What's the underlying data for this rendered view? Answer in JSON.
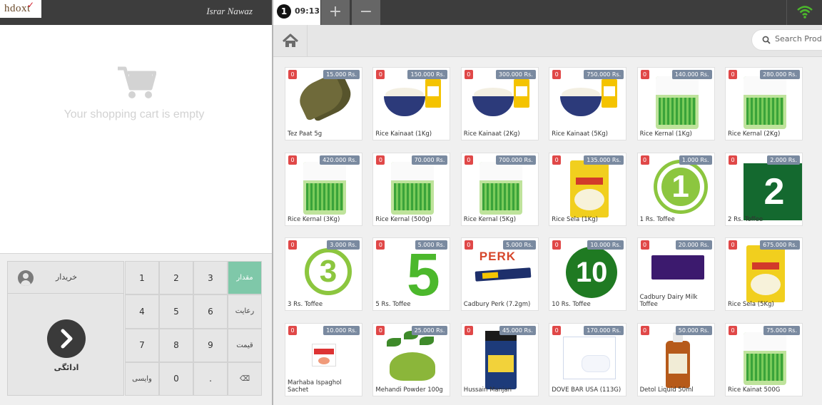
{
  "header": {
    "logo_text": "hdoxt",
    "user_name": "Israr Nawaz"
  },
  "cart": {
    "empty_message": "Your shopping cart is empty"
  },
  "customer": {
    "label": "خریدار"
  },
  "payment": {
    "label": "ادائگی"
  },
  "keypad": {
    "keys": [
      {
        "label": "1",
        "type": "digit"
      },
      {
        "label": "2",
        "type": "digit"
      },
      {
        "label": "3",
        "type": "digit"
      },
      {
        "label": "مقدار",
        "type": "func",
        "active": true
      },
      {
        "label": "4",
        "type": "digit"
      },
      {
        "label": "5",
        "type": "digit"
      },
      {
        "label": "6",
        "type": "digit"
      },
      {
        "label": "رعایت",
        "type": "func"
      },
      {
        "label": "7",
        "type": "digit"
      },
      {
        "label": "8",
        "type": "digit"
      },
      {
        "label": "9",
        "type": "digit"
      },
      {
        "label": "قیمت",
        "type": "func"
      },
      {
        "label": "وایسی",
        "type": "func"
      },
      {
        "label": "0",
        "type": "digit"
      },
      {
        "label": ".",
        "type": "digit"
      },
      {
        "label": "⌫",
        "type": "backspace"
      }
    ]
  },
  "order_tab": {
    "number": "1",
    "time": "09:13",
    "add_label": "+",
    "remove_label": "−"
  },
  "search": {
    "placeholder": "Search Produ"
  },
  "colors": {
    "topbar": "#3d3d3d",
    "qty_badge": "#e04848",
    "price_badge": "#7a8aa0",
    "active_key": "#7fc8a9",
    "wifi": "#4cb82c"
  },
  "products": [
    {
      "name": "Tez Paat 5g",
      "price": "15.000 Rs.",
      "qty": "0",
      "image": "bay-leaves"
    },
    {
      "name": "Rice Kainaat (1Kg)",
      "price": "150.000 Rs.",
      "qty": "0",
      "image": "rice-bowl"
    },
    {
      "name": "Rice Kainaat (2Kg)",
      "price": "300.000 Rs.",
      "qty": "0",
      "image": "rice-bowl"
    },
    {
      "name": "Rice Kainaat (5Kg)",
      "price": "750.000 Rs.",
      "qty": "0",
      "image": "rice-bowl"
    },
    {
      "name": "Rice Kernal (1Kg)",
      "price": "140.000 Rs.",
      "qty": "0",
      "image": "kernel-bag"
    },
    {
      "name": "Rice Kernal (2Kg)",
      "price": "280.000 Rs.",
      "qty": "0",
      "image": "kernel-bag"
    },
    {
      "name": "Rice Kernal (3Kg)",
      "price": "420.000 Rs.",
      "qty": "0",
      "image": "kernel-bag"
    },
    {
      "name": "Rice Kernal (500g)",
      "price": "70.000 Rs.",
      "qty": "0",
      "image": "kernel-bag"
    },
    {
      "name": "Rice Kernal (5Kg)",
      "price": "700.000 Rs.",
      "qty": "0",
      "image": "kernel-bag"
    },
    {
      "name": "Rice Sela (1Kg)",
      "price": "135.000 Rs.",
      "qty": "0",
      "image": "sela-bag"
    },
    {
      "name": "1 Rs. Toffee",
      "price": "1.000 Rs.",
      "qty": "0",
      "image": "number-1"
    },
    {
      "name": "2 Rs. Toffee",
      "price": "2.000 Rs.",
      "qty": "0",
      "image": "number-2"
    },
    {
      "name": "3 Rs. Toffee",
      "price": "3.000 Rs.",
      "qty": "0",
      "image": "number-3"
    },
    {
      "name": "5 Rs. Toffee",
      "price": "5.000 Rs.",
      "qty": "0",
      "image": "number-5"
    },
    {
      "name": "Cadbury Perk (7.2gm)",
      "price": "5.000 Rs.",
      "qty": "0",
      "image": "perk-bar"
    },
    {
      "name": "10 Rs. Toffee",
      "price": "10.000 Rs.",
      "qty": "0",
      "image": "number-10"
    },
    {
      "name": "Cadbury Dairy Milk Toffee",
      "price": "20.000 Rs.",
      "qty": "0",
      "image": "dairy-milk"
    },
    {
      "name": "Rice Sela (5Kg)",
      "price": "675.000 Rs.",
      "qty": "0",
      "image": "sela-bag"
    },
    {
      "name": "Marhaba Ispaghol Sachet",
      "price": "10.000 Rs.",
      "qty": "0",
      "image": "ispaghol"
    },
    {
      "name": "Mehandi Powder 100g",
      "price": "25.000 Rs.",
      "qty": "0",
      "image": "mehndi"
    },
    {
      "name": "Hussain Manjan",
      "price": "45.000 Rs.",
      "qty": "0",
      "image": "manjan-jar"
    },
    {
      "name": "DOVE BAR USA (113G)",
      "price": "170.000 Rs.",
      "qty": "0",
      "image": "dove"
    },
    {
      "name": "Detol Liquid 50ml",
      "price": "50.000 Rs.",
      "qty": "0",
      "image": "dettol"
    },
    {
      "name": "Rice Kainat 500G",
      "price": "75.000 Rs.",
      "qty": "0",
      "image": "kernel-bag"
    }
  ]
}
